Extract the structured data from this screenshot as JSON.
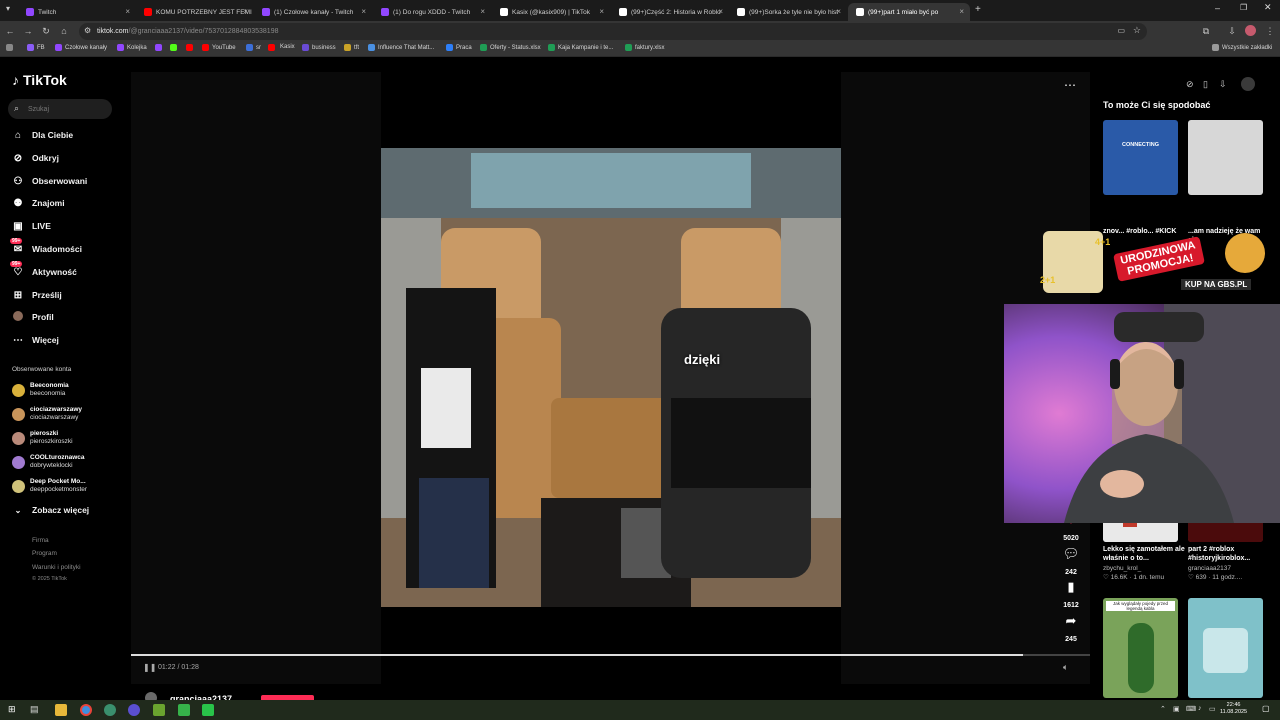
{
  "tabs": [
    {
      "title": "Twitch",
      "color": "#9147ff"
    },
    {
      "title": "KOMU POTRZEBNY JEST FEMI",
      "color": "#ff0000"
    },
    {
      "title": "(1) Czołowe kanały - Twitch",
      "color": "#9147ff"
    },
    {
      "title": "(1) Do rogu XDDD - Twitch",
      "color": "#9147ff"
    },
    {
      "title": "Kasix (@kasix909) | TikTok",
      "color": "#ffffff"
    },
    {
      "title": "(99+)Część 2: Historia w Roblo",
      "color": "#ffffff"
    },
    {
      "title": "(99+)Sorka że tyle nie było hist",
      "color": "#ffffff"
    },
    {
      "title": "(99+)part 1 miało być po",
      "color": "#ffffff"
    }
  ],
  "url": {
    "host": "tiktok.com",
    "path": "/@granciaaa2137/video/7537012884803538198"
  },
  "bookmarks": [
    {
      "label": "FB",
      "color": "#8a5cf6"
    },
    {
      "label": "Czołowe kanały",
      "color": "#9147ff"
    },
    {
      "label": "Kolejka",
      "color": "#9147ff"
    },
    {
      "label": "",
      "color": "#9147ff"
    },
    {
      "label": "",
      "color": "#53fc18"
    },
    {
      "label": "",
      "color": "#ff0000"
    },
    {
      "label": "YouTube",
      "color": "#ff0000"
    },
    {
      "label": "sr",
      "color": "#3c6fd8"
    },
    {
      "label": "",
      "color": "#ff0000"
    },
    {
      "label": "Kasix",
      "color": "#e05a2b"
    },
    {
      "label": "business",
      "color": "#6a4bd6"
    },
    {
      "label": "tft",
      "color": "#c9a227"
    },
    {
      "label": "Influence That Matt...",
      "color": "#4a90e2"
    },
    {
      "label": "Praca",
      "color": "#2d7ff9"
    },
    {
      "label": "Oferty - Status.xlsx",
      "color": "#1f9d55"
    },
    {
      "label": "Kaja Kampanie i te...",
      "color": "#1f9d55"
    },
    {
      "label": "faktury.xlsx",
      "color": "#1f9d55"
    }
  ],
  "all_bookmarks": "Wszystkie zakładki",
  "logo": "TikTok",
  "search_placeholder": "Szukaj",
  "nav": [
    {
      "label": "Dla Ciebie",
      "icon": "home-icon"
    },
    {
      "label": "Odkryj",
      "icon": "compass-icon"
    },
    {
      "label": "Obserwowani",
      "icon": "following-icon"
    },
    {
      "label": "Znajomi",
      "icon": "friends-icon"
    },
    {
      "label": "LIVE",
      "icon": "live-icon"
    },
    {
      "label": "Wiadomości",
      "icon": "messages-icon",
      "badge": "99+"
    },
    {
      "label": "Aktywność",
      "icon": "activity-icon",
      "badge": "99+"
    },
    {
      "label": "Prześlij",
      "icon": "upload-icon"
    },
    {
      "label": "Profil",
      "icon": "profile-icon"
    },
    {
      "label": "Więcej",
      "icon": "more-icon"
    }
  ],
  "followed_title": "Obserwowane konta",
  "followed": [
    {
      "name": "Beeconomia",
      "handle": "beeconomia",
      "color": "#d9b13b"
    },
    {
      "name": "ciociazwarszawy",
      "handle": "ciociazwarszawy",
      "color": "#c8945a"
    },
    {
      "name": "pieroszki",
      "handle": "pieroszkiroszki",
      "color": "#b98a7a"
    },
    {
      "name": "COOLturoznawca",
      "handle": "dobrywteklocki",
      "color": "#a07ad0"
    },
    {
      "name": "Deep Pocket Mo...",
      "handle": "deeppocketmonster",
      "color": "#d0c27a"
    }
  ],
  "see_more": "Zobacz więcej",
  "footer": [
    "Firma",
    "Program",
    "Warunki i polityki",
    "© 2025 TikTok"
  ],
  "video": {
    "caption": "dzięki",
    "time": "01:22 / 01:28",
    "progress": 0.93
  },
  "actions": [
    {
      "icon": "heart-icon",
      "count": "5020",
      "color": "#fe2c55"
    },
    {
      "icon": "comment-icon",
      "count": "242",
      "color": "#ffffff"
    },
    {
      "icon": "bookmark-icon",
      "count": "1612",
      "color": "#ffffff"
    },
    {
      "icon": "share-icon",
      "count": "245",
      "color": "#ffffff"
    }
  ],
  "author": "granciaaa2137",
  "right_title": "To może Ci się spodobać",
  "recs": [
    {
      "caption": "znov... #roblo... #KICK",
      "thumb_color": "#2a5aa8",
      "thumb_text": "CONNECTING"
    },
    {
      "caption": "...am nadzieję że wam si...",
      "thumb_color": "#d7d7d7",
      "thumb_text": ""
    },
    {
      "caption": "Lekko się zamotałem ale właśnie o to...",
      "author": "zbychu_krol_",
      "meta": "♡ 16.6K · 1 dn. temu",
      "thumb_color": "#a7b9c9",
      "thumb_text": ""
    },
    {
      "caption": "part 2 #roblox #historyjkiroblox...",
      "author": "granciaaa2137",
      "meta": "♡ 639 · 11 godz....",
      "thumb_color": "#b51d20",
      "thumb_text": ""
    },
    {
      "caption": "",
      "thumb_color": "#7aa35a",
      "thumb_text": "Jak wyglądały pojedy przed legendą kabla"
    },
    {
      "caption": "",
      "thumb_color": "#7fc1c9",
      "thumb_text": ""
    }
  ],
  "promo": {
    "line1": "URODZINOWA",
    "line2": "PROMOCJA!",
    "cta": "KUP NA GBS.PL",
    "offer": "4+1",
    "offer2": "2+1"
  },
  "clock": {
    "time": "22:46",
    "date": "11.08.2025"
  }
}
